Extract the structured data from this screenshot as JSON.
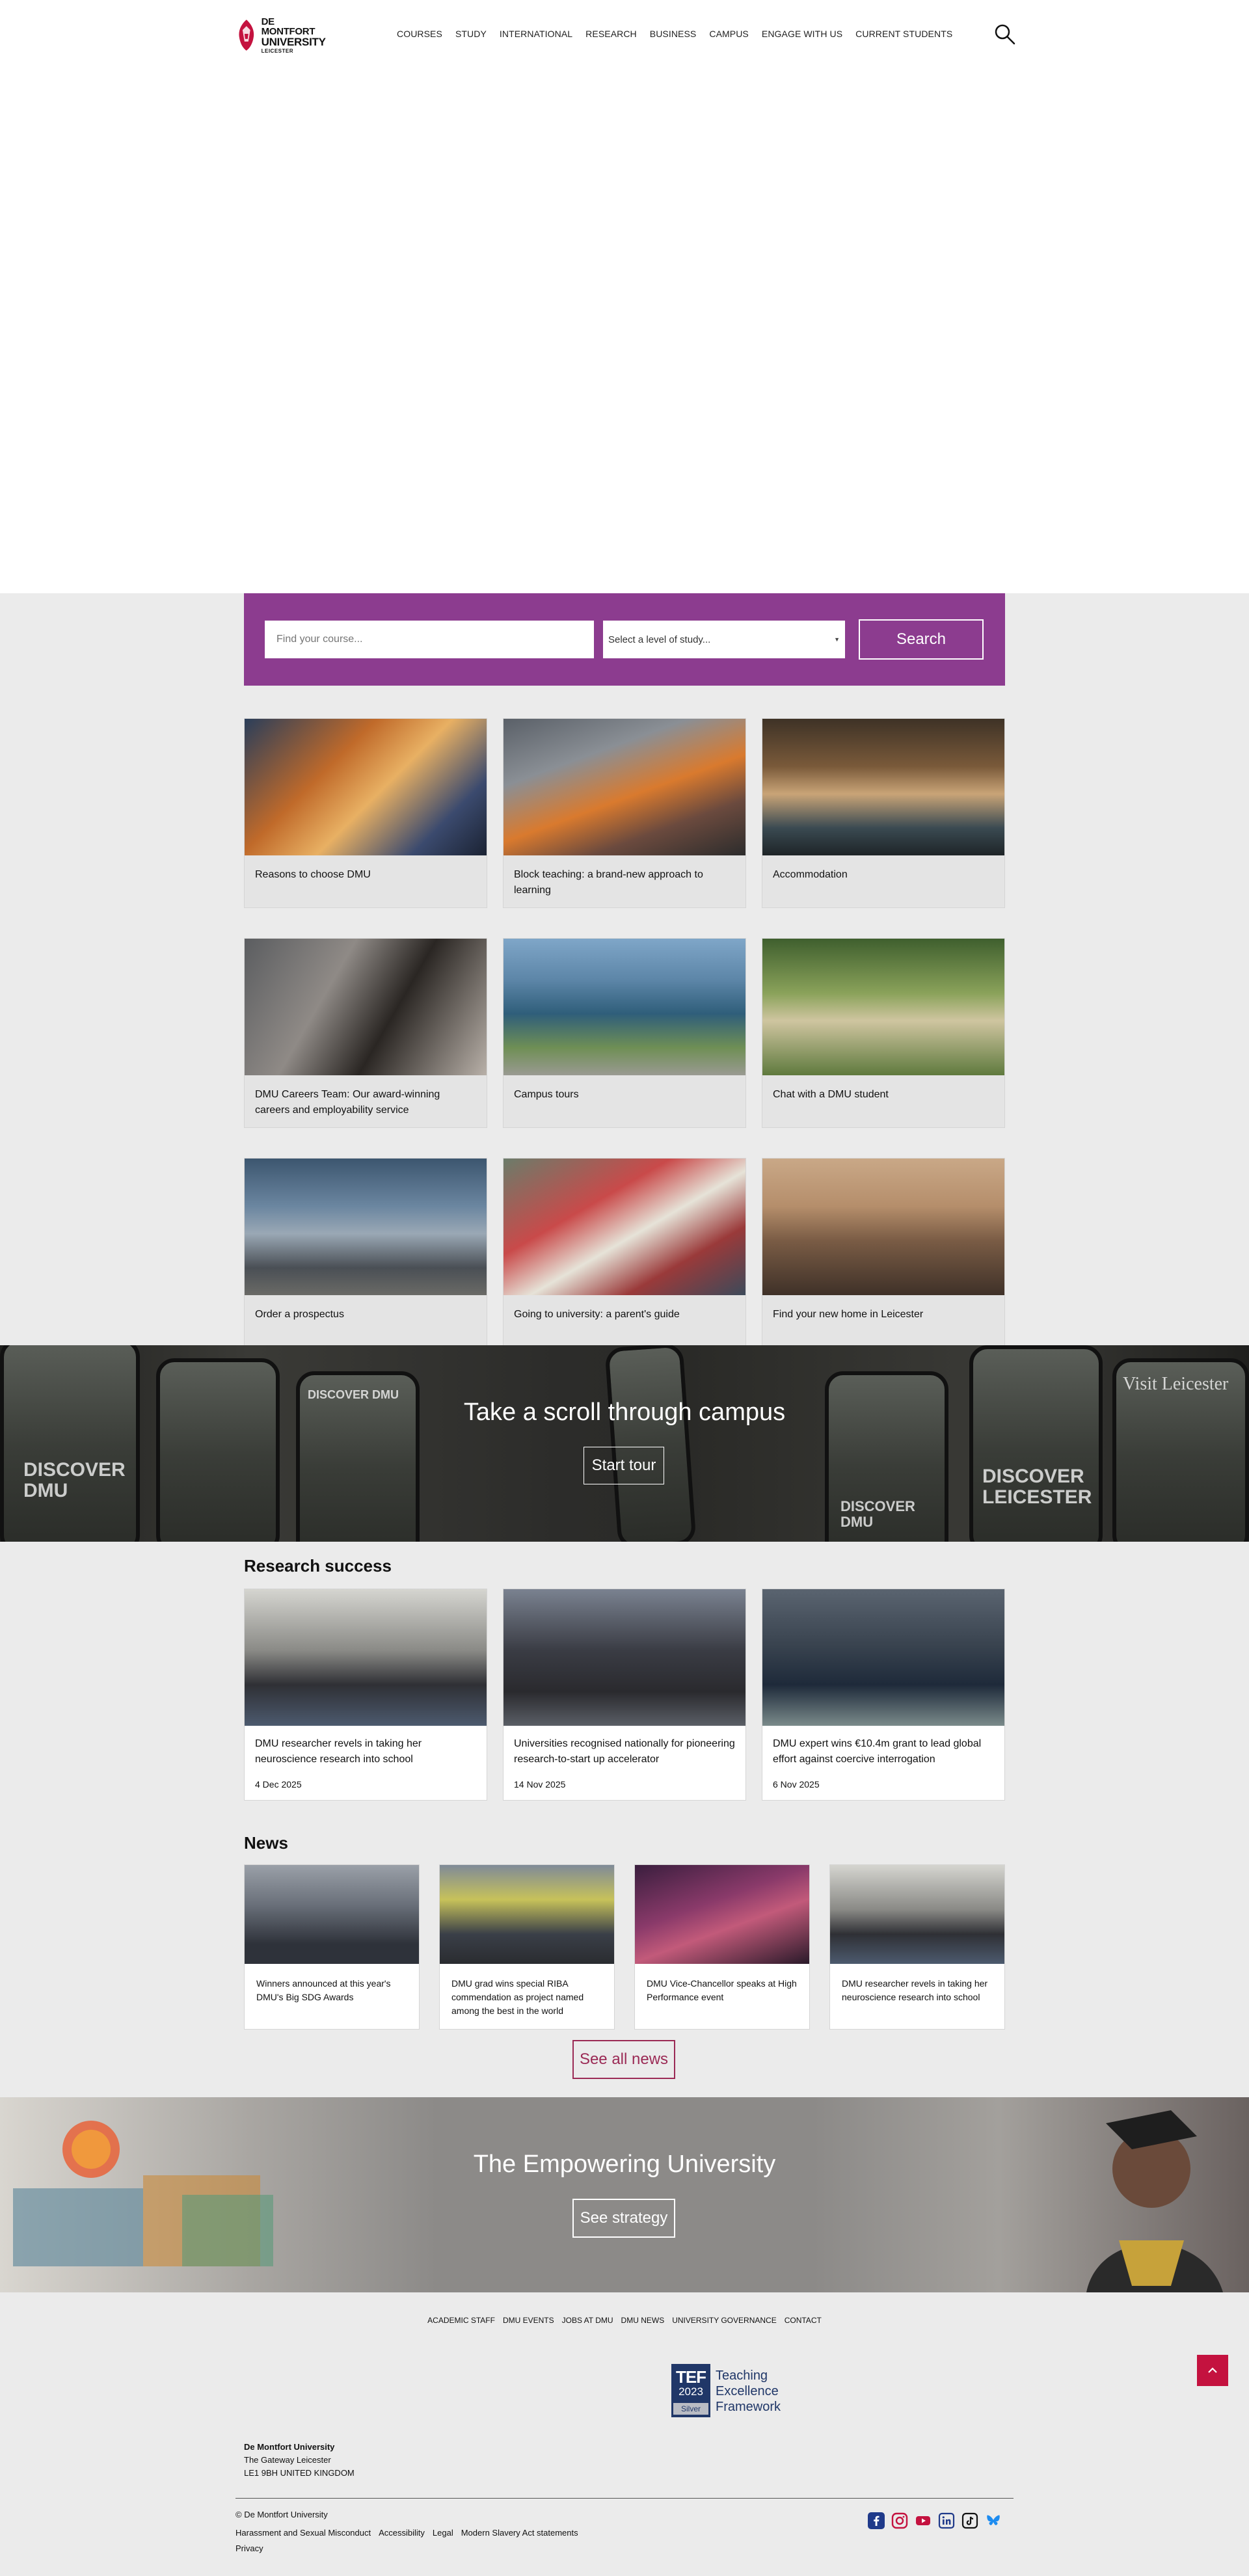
{
  "header": {
    "logo": {
      "line1": "DE MONTFORT",
      "line2": "UNIVERSITY",
      "line3": "LEICESTER"
    },
    "nav": [
      "COURSES",
      "STUDY",
      "INTERNATIONAL",
      "RESEARCH",
      "BUSINESS",
      "CAMPUS",
      "ENGAGE WITH US",
      "CURRENT STUDENTS"
    ],
    "search_icon": "search-icon"
  },
  "course_search": {
    "input_placeholder": "Find your course...",
    "level_label": "Select a level of study...",
    "button_label": "Search",
    "background": "#8c3c8f"
  },
  "feature_cards": [
    "Reasons to choose DMU",
    "Block teaching: a brand-new approach to learning",
    "Accommodation",
    "DMU Careers Team: Our award-winning careers and employability service",
    "Campus tours",
    "Chat with a DMU student",
    "Order a prospectus",
    "Going to university: a parent's guide",
    "Find your new home in Leicester"
  ],
  "tour_banner": {
    "title": "Take a scroll through campus",
    "button_label": "Start tour",
    "phone_texts": [
      "DISCOVER DMU",
      "DISCOVER DMU",
      "DISCOVER DMU",
      "DISCOVER LEICESTER",
      "Visit Leicester"
    ]
  },
  "research": {
    "title": "Research success",
    "items": [
      {
        "title": "DMU researcher revels in taking her neuroscience research into school",
        "date": "4 Dec 2025"
      },
      {
        "title": "Universities recognised nationally for pioneering research-to-start up accelerator",
        "date": "14 Nov 2025"
      },
      {
        "title": "DMU expert wins €10.4m grant to lead global effort against coercive interrogation",
        "date": "6 Nov 2025"
      }
    ]
  },
  "news": {
    "title": "News",
    "items": [
      "Winners announced at this year's DMU's Big SDG Awards",
      "DMU grad wins special RIBA commendation as project named among the best in the world",
      "DMU Vice-Chancellor speaks at High Performance event",
      "DMU researcher revels in taking her neuroscience research into school"
    ],
    "see_all_label": "See all news"
  },
  "empowering": {
    "title": "The Empowering University",
    "button_label": "See strategy"
  },
  "footer": {
    "links": [
      "ACADEMIC STAFF",
      "DMU EVENTS",
      "JOBS AT DMU",
      "DMU NEWS",
      "UNIVERSITY GOVERNANCE",
      "CONTACT"
    ],
    "tef": {
      "word": "TEF",
      "year": "2023",
      "medal": "Silver",
      "line1": "Teaching",
      "line2": "Excellence",
      "line3": "Framework"
    },
    "address": {
      "name": "De Montfort University",
      "line1": "The Gateway  Leicester",
      "line2": "LE1 9BH  UNITED KINGDOM"
    },
    "copyright": "© De Montfort University",
    "legal": [
      "Harassment and Sexual Misconduct",
      "Accessibility",
      "Legal",
      "Modern Slavery Act statements"
    ],
    "privacy": "Privacy",
    "socials": [
      "facebook-icon",
      "instagram-icon",
      "youtube-icon",
      "linkedin-icon",
      "tiktok-icon",
      "bluesky-icon"
    ]
  },
  "colors": {
    "brand_red": "#c4123f",
    "purple": "#8c3c8f",
    "see_all_border": "#9b2a55",
    "tef_navy": "#203768"
  }
}
